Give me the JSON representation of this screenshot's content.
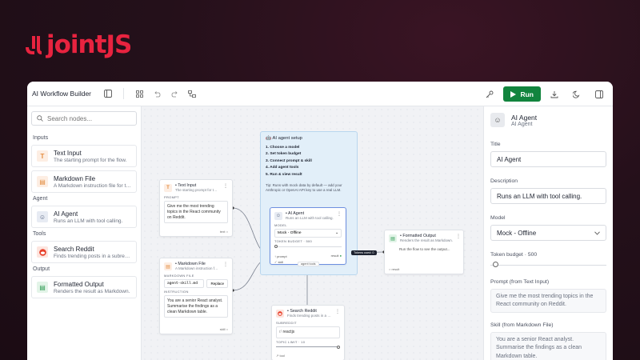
{
  "brand": {
    "logo_text": "jointJS",
    "color": "#e8233f"
  },
  "toolbar": {
    "title": "AI Workflow Builder",
    "run_label": "Run",
    "icons": [
      "sidebar-toggle-icon",
      "grid-icon",
      "undo-icon",
      "redo-icon",
      "layout-icon",
      "key-icon",
      "play-icon",
      "download-icon",
      "theme-moon-icon",
      "panel-right-icon"
    ]
  },
  "sidebar": {
    "search_placeholder": "Search nodes...",
    "sections": [
      {
        "label": "Inputs",
        "items": [
          {
            "title": "Text Input",
            "desc": "The starting prompt for the flow.",
            "icon": "text-icon"
          },
          {
            "title": "Markdown File",
            "desc": "A Markdown instruction file for the…",
            "icon": "file-icon"
          }
        ]
      },
      {
        "label": "Agent",
        "items": [
          {
            "title": "AI Agent",
            "desc": "Runs an LLM with tool calling.",
            "icon": "bot-icon"
          }
        ]
      },
      {
        "label": "Tools",
        "items": [
          {
            "title": "Search Reddit",
            "desc": "Finds trending posts in a subred…",
            "icon": "reddit-icon"
          }
        ]
      },
      {
        "label": "Output",
        "items": [
          {
            "title": "Formatted Output",
            "desc": "Renders the result as Markdown.",
            "icon": "output-icon"
          }
        ]
      }
    ]
  },
  "canvas": {
    "setup": {
      "title": "AI agent setup",
      "steps": [
        "1. Choose a model",
        "2. Set token budget",
        "3. Connect prompt & skill",
        "4. Add agent tools",
        "5. Run & view result"
      ],
      "tip": "Tip: Runs with mock data by default — add your Anthropic or OpenAI API key to use a real LLM."
    },
    "text_input": {
      "title": "Text Input",
      "desc": "The starting prompt for t…",
      "field_label": "PROMPT",
      "value": "Give me the most trending topics in the React community on Reddit.",
      "port": "text"
    },
    "markdown_file": {
      "title": "Markdown File",
      "desc": "A Markdown instruction f…",
      "field_label": "MARKDOWN FILE",
      "file": "agent-skill.md",
      "replace": "Replace",
      "instr_label": "INSTRUCTION",
      "instruction": "You are a senior React analyst. Summarise the findings as a clean Markdown table.",
      "port": "skill"
    },
    "ai_agent": {
      "title": "AI Agent",
      "desc": "Runs an LLM with tool calling.",
      "model_label": "MODEL",
      "model": "Mock - Offline",
      "budget_label": "TOKEN BUDGET · 500",
      "in_prompt": "prompt",
      "in_skill": "skill",
      "out_result": "result",
      "tools_label": "agent tools",
      "tokens_badge": "Tokens used: 0"
    },
    "formatted_output": {
      "title": "Formatted Output",
      "desc": "Renders the result as Markdown.",
      "body": "Run the flow to see the output...",
      "port": "result"
    },
    "search_reddit": {
      "title": "Search Reddit",
      "desc": "Finds trending posts in a …",
      "sub_label": "SUBREDDIT",
      "subreddit": "reactjs",
      "limit_label": "TOPIC LIMIT · 10",
      "port": "tool"
    }
  },
  "properties": {
    "name": "AI Agent",
    "type": "AI Agent",
    "title_label": "Title",
    "title_value": "AI Agent",
    "desc_label": "Description",
    "desc_value": "Runs an LLM with tool calling.",
    "model_label": "Model",
    "model_value": "Mock - Offline",
    "budget_label": "Token budget · 500",
    "budget_fraction": 0.02,
    "prompt_label": "Prompt (from Text Input)",
    "prompt_value": "Give me the most trending topics in the React community on Reddit.",
    "skill_label": "Skill (from Markdown File)",
    "skill_value": "You are a senior React analyst. Summarise the findings as a clean Markdown table."
  }
}
